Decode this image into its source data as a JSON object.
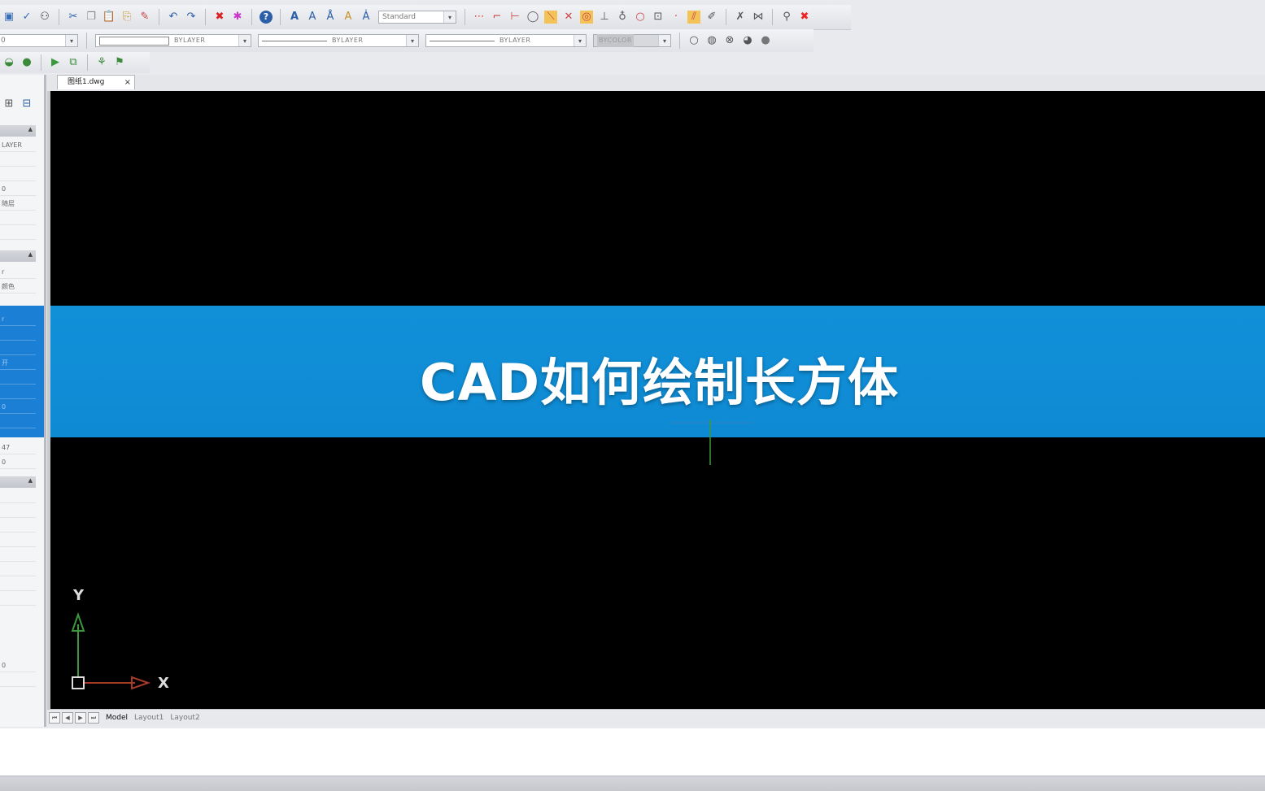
{
  "toolbar": {
    "text_style_value": "Standard",
    "layer_value": "0",
    "color_value": "BYLAYER",
    "linetype_value": "BYLAYER",
    "lineweight_value": "BYLAYER",
    "plotstyle_value": "BYCOLOR"
  },
  "left_panel": {
    "rows": [
      "LAYER",
      "",
      "",
      "0",
      "随层",
      "",
      "",
      "",
      "r",
      "颜色",
      "",
      "47",
      "0",
      "",
      "",
      "",
      "",
      "",
      "",
      "",
      "",
      "",
      "0",
      ""
    ],
    "blue_rows": [
      "r",
      "",
      "",
      "开",
      "",
      "",
      "0",
      ""
    ]
  },
  "document_tab": {
    "label": "图纸1.dwg",
    "close": "×"
  },
  "banner": {
    "title": "CAD如何绘制长方体"
  },
  "ucs": {
    "x_label": "X",
    "y_label": "Y"
  },
  "layout_tabs": [
    "Model",
    "Layout1",
    "Layout2"
  ],
  "colors": {
    "canvas": "#000000",
    "banner": "#1190d8",
    "x_axis": "#a83a2a",
    "y_axis": "#3a9a3a"
  }
}
